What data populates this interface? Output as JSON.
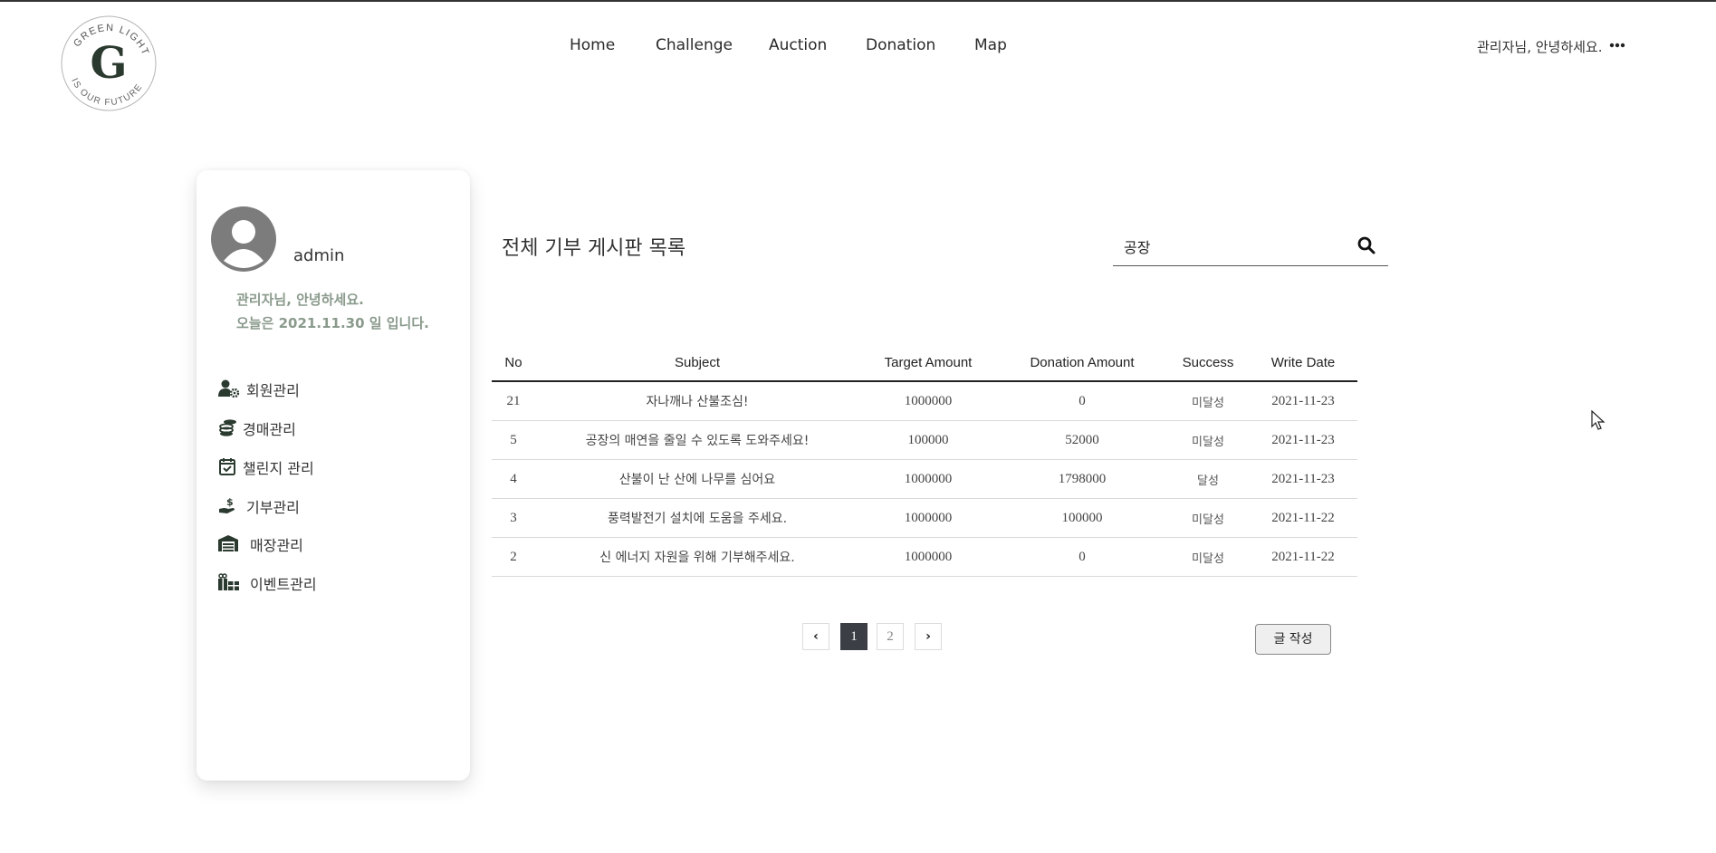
{
  "logo": {
    "letter": "G",
    "arc_top": "GREEN  LIGHT",
    "arc_bottom": "IS OUR FUTURE"
  },
  "nav": {
    "items": [
      {
        "label": "Home"
      },
      {
        "label": "Challenge"
      },
      {
        "label": "Auction"
      },
      {
        "label": "Donation"
      },
      {
        "label": "Map"
      }
    ],
    "greeting": "관리자님, 안녕하세요.",
    "more_icon": "more-horizontal-icon"
  },
  "sidebar": {
    "username": "admin",
    "greeting_line1": "관리자님, 안녕하세요.",
    "greeting_line2": "오늘은 2021.11.30 일 입니다.",
    "menu": [
      {
        "label": "회원관리",
        "icon": "user-gear-icon"
      },
      {
        "label": "경매관리",
        "icon": "coins-icon"
      },
      {
        "label": "챌린지 관리",
        "icon": "calendar-check-icon"
      },
      {
        "label": "기부관리",
        "icon": "hand-dollar-icon"
      },
      {
        "label": "매장관리",
        "icon": "warehouse-icon"
      },
      {
        "label": "이벤트관리",
        "icon": "gifts-icon"
      }
    ]
  },
  "main": {
    "title": "전체 기부 게시판 목록",
    "search": {
      "value": "공장",
      "placeholder": ""
    },
    "table": {
      "columns": [
        "No",
        "Subject",
        "Target Amount",
        "Donation Amount",
        "Success",
        "Write Date"
      ],
      "rows": [
        [
          "21",
          "자나깨나 산불조심!",
          "1000000",
          "0",
          "미달성",
          "2021-11-23"
        ],
        [
          "5",
          "공장의 매연을 줄일 수 있도록 도와주세요!",
          "100000",
          "52000",
          "미달성",
          "2021-11-23"
        ],
        [
          "4",
          "산불이 난 산에 나무를 심어요",
          "1000000",
          "1798000",
          "달성",
          "2021-11-23"
        ],
        [
          "3",
          "풍력발전기 설치에 도움을 주세요.",
          "1000000",
          "100000",
          "미달성",
          "2021-11-22"
        ],
        [
          "2",
          "신 에너지 자원을 위해 기부해주세요.",
          "1000000",
          "0",
          "미달성",
          "2021-11-22"
        ]
      ]
    },
    "pagination": {
      "prev": "‹",
      "pages": [
        "1",
        "2"
      ],
      "current": "1",
      "next": "›"
    },
    "write_button": "글 작성"
  },
  "colors": {
    "dark_green": "#2b3a2f",
    "greeting_green": "#8a9a8c",
    "active_page": "#3b3f45"
  }
}
